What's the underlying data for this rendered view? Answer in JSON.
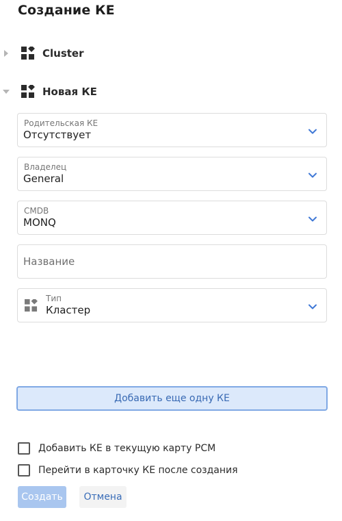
{
  "header": {
    "title": "Создание КЕ"
  },
  "tree": {
    "nodes": [
      {
        "label": "Cluster",
        "icon": "widgets-icon",
        "expanded": false
      },
      {
        "label": "Новая КЕ",
        "icon": "widgets-icon",
        "expanded": true
      }
    ]
  },
  "form": {
    "parent": {
      "label": "Родительская КЕ",
      "value": "Отсутствует"
    },
    "owner": {
      "label": "Владелец",
      "value": "General"
    },
    "cmdb": {
      "label": "CMDB",
      "value": "MONQ"
    },
    "name": {
      "placeholder": "Название",
      "value": ""
    },
    "type": {
      "label": "Тип",
      "value": "Кластер",
      "icon": "widgets-icon"
    }
  },
  "actions": {
    "add_another_label": "Добавить еще одну КЕ",
    "checkbox_add_to_map": {
      "label": "Добавить КЕ в текущую карту РСМ",
      "checked": false
    },
    "checkbox_go_to_card": {
      "label": "Перейти в карточку КЕ после создания",
      "checked": false
    },
    "create_label": "Создать",
    "cancel_label": "Отмена"
  },
  "colors": {
    "accent": "#3f78d6",
    "create_disabled": "#a9c6ef",
    "add_button_bg": "#dce9fb",
    "add_button_border": "#7fa8e4"
  }
}
